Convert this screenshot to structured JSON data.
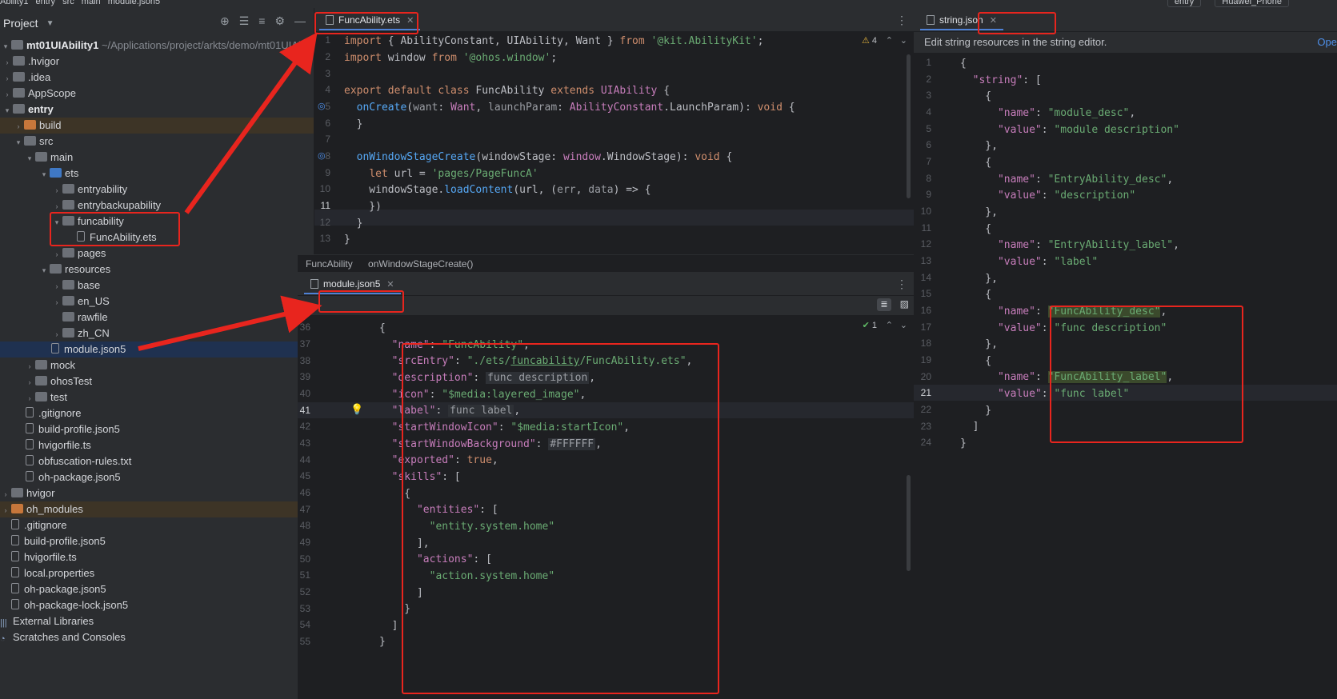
{
  "topbar": {
    "crumbs": [
      "Ability1",
      "entry",
      "src",
      "main",
      "module.json5"
    ],
    "run_config": "entry",
    "device": "Huawei_Phone"
  },
  "project": {
    "title": "Project",
    "root_name": "mt01UIAbility1",
    "root_path": "~/Applications/project/arkts/demo/mt01UIAb",
    "items": [
      {
        "label": ".hvigor"
      },
      {
        "label": ".idea"
      },
      {
        "label": "AppScope"
      },
      {
        "label": "entry"
      },
      {
        "label": "build"
      },
      {
        "label": "src"
      },
      {
        "label": "main"
      },
      {
        "label": "ets"
      },
      {
        "label": "entryability"
      },
      {
        "label": "entrybackupability"
      },
      {
        "label": "funcability"
      },
      {
        "label": "FuncAbility.ets"
      },
      {
        "label": "pages"
      },
      {
        "label": "resources"
      },
      {
        "label": "base"
      },
      {
        "label": "en_US"
      },
      {
        "label": "rawfile"
      },
      {
        "label": "zh_CN"
      },
      {
        "label": "module.json5"
      },
      {
        "label": "mock"
      },
      {
        "label": "ohosTest"
      },
      {
        "label": "test"
      },
      {
        "label": ".gitignore"
      },
      {
        "label": "build-profile.json5"
      },
      {
        "label": "hvigorfile.ts"
      },
      {
        "label": "obfuscation-rules.txt"
      },
      {
        "label": "oh-package.json5"
      },
      {
        "label": "hvigor"
      },
      {
        "label": "oh_modules"
      },
      {
        "label": ".gitignore"
      },
      {
        "label": "build-profile.json5"
      },
      {
        "label": "hvigorfile.ts"
      },
      {
        "label": "local.properties"
      },
      {
        "label": "oh-package.json5"
      },
      {
        "label": "oh-package-lock.json5"
      },
      {
        "label": "External Libraries"
      },
      {
        "label": "Scratches and Consoles"
      }
    ]
  },
  "editor_top": {
    "tab": "FuncAbility.ets",
    "warnings": "4",
    "breadcrumb": [
      "FuncAbility",
      "onWindowStageCreate()"
    ],
    "line_numbers": [
      "1",
      "2",
      "3",
      "4",
      "5",
      "6",
      "7",
      "8",
      "9",
      "10",
      "11",
      "12",
      "13"
    ]
  },
  "editor_bottom": {
    "tab": "module.json5",
    "checks": "1",
    "line_numbers": [
      "36",
      "37",
      "38",
      "39",
      "40",
      "41",
      "42",
      "43",
      "44",
      "45",
      "46",
      "47",
      "48",
      "49",
      "50",
      "51",
      "52",
      "53",
      "54",
      "55"
    ]
  },
  "editor_right": {
    "tab": "string.json",
    "info": "Edit string resources in the string editor.",
    "open_link": "Ope",
    "line_numbers": [
      "1",
      "2",
      "3",
      "4",
      "5",
      "6",
      "7",
      "8",
      "9",
      "10",
      "11",
      "12",
      "13",
      "14",
      "15",
      "16",
      "17",
      "18",
      "19",
      "20",
      "21",
      "22",
      "23",
      "24"
    ]
  },
  "colors": {
    "annotation_red": "#e8251e",
    "tab_underline": "#4e81d6"
  }
}
